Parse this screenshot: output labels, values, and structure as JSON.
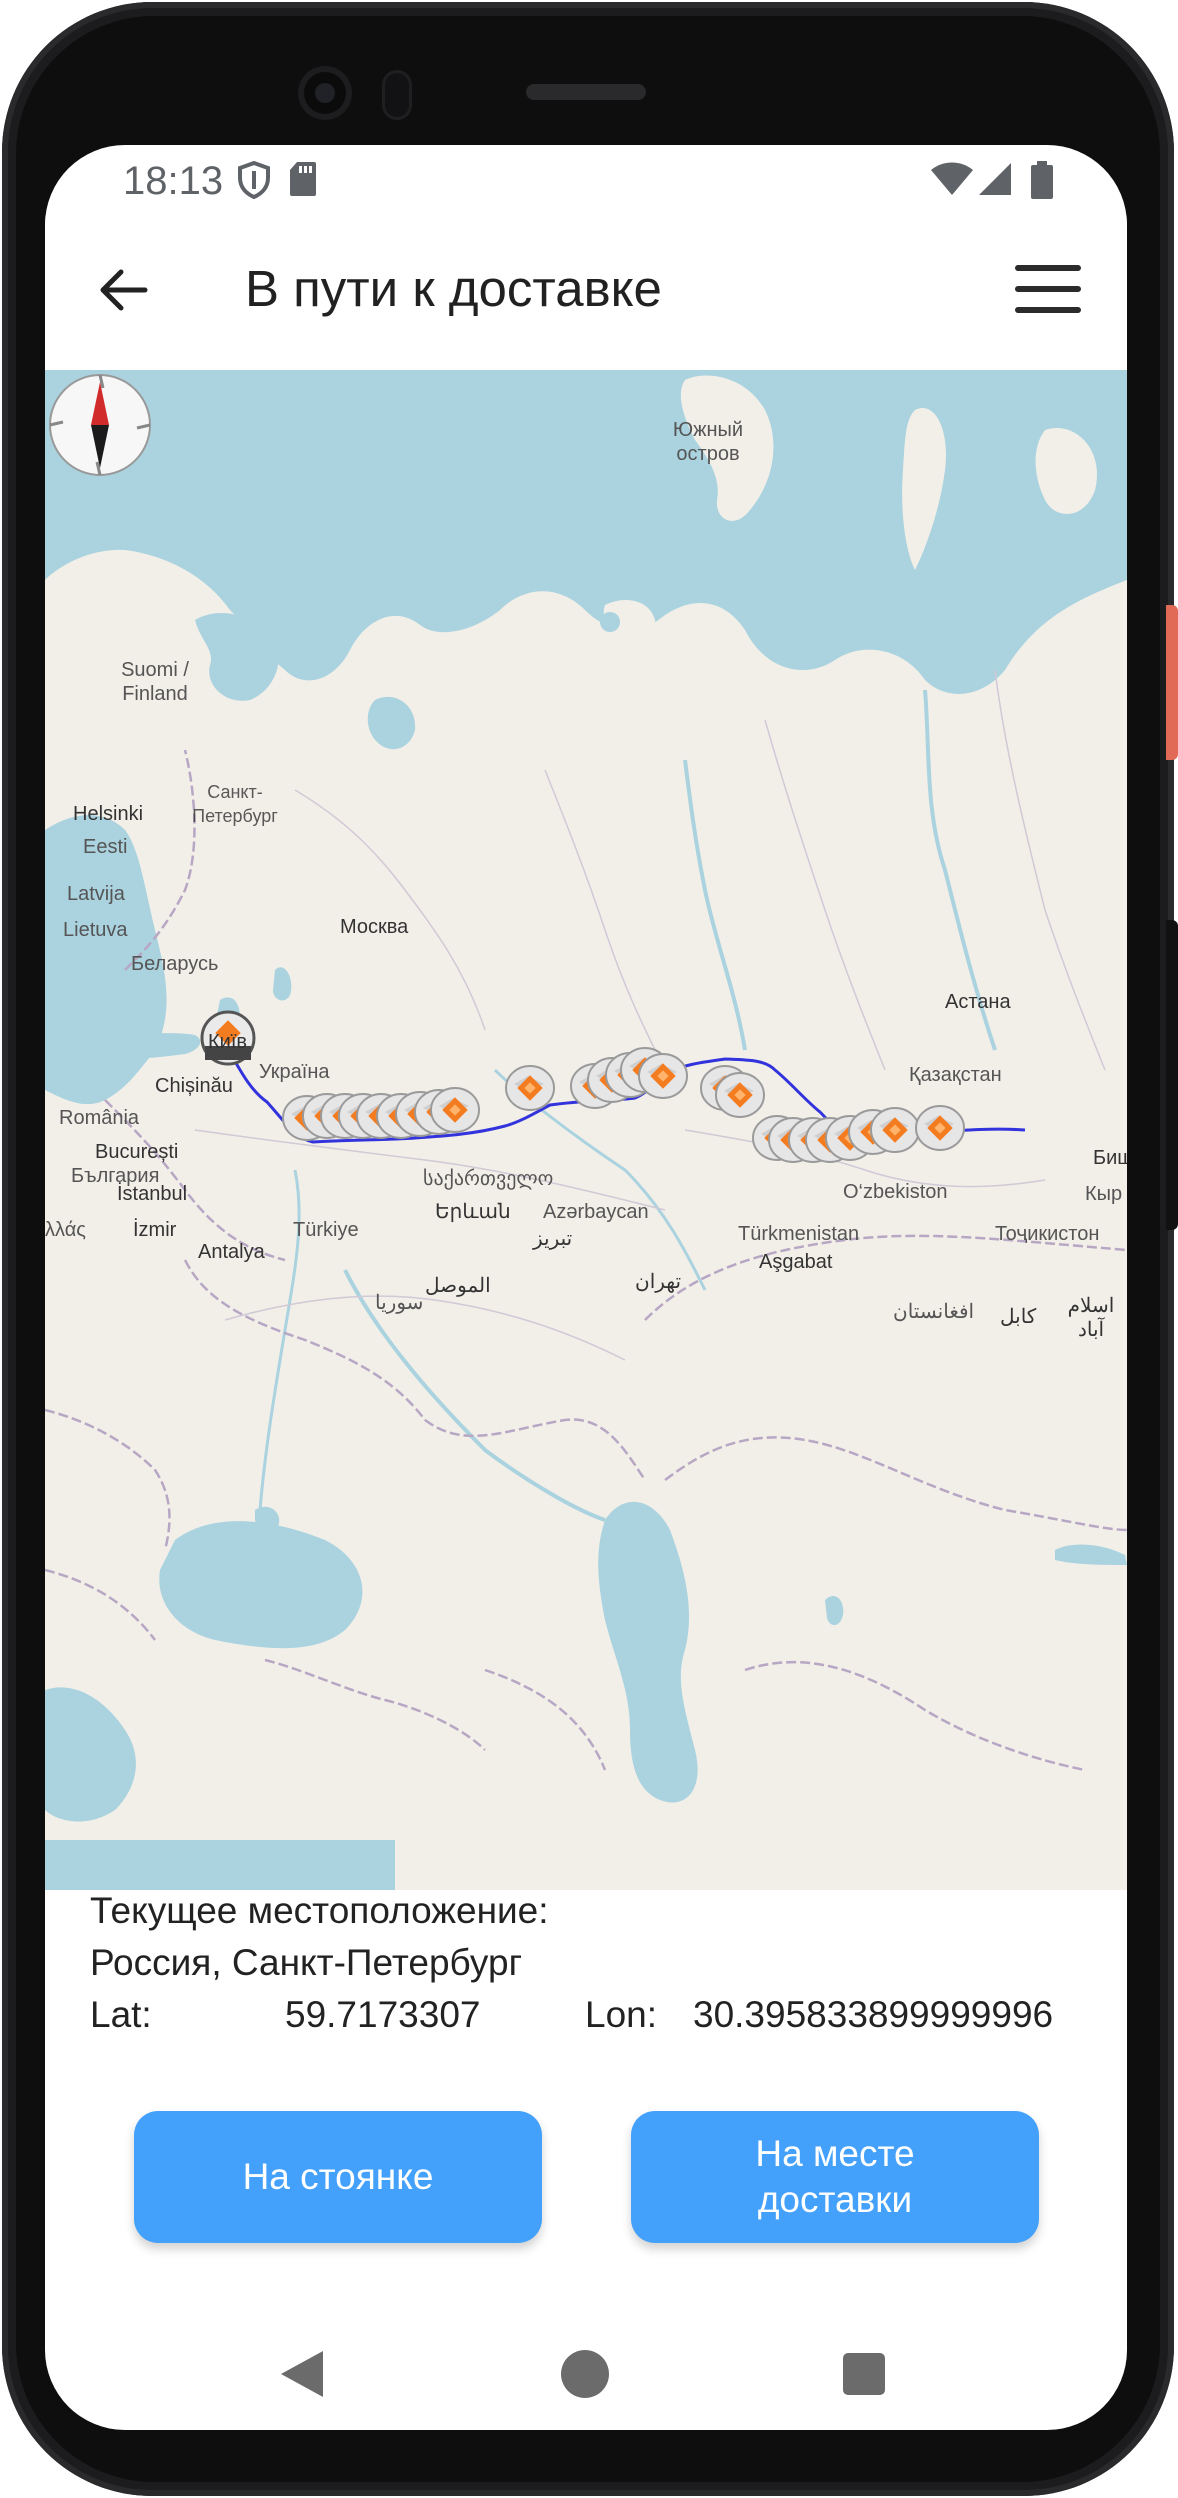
{
  "status_bar": {
    "time": "18:13",
    "icons": [
      "shield-icon",
      "sd-card-icon",
      "wifi-icon",
      "signal-icon",
      "battery-icon"
    ]
  },
  "app_bar": {
    "title": "В пути к доставке",
    "back_icon": "arrow-back-icon",
    "menu_icon": "hamburger-menu-icon"
  },
  "map": {
    "compass_icon": "compass-icon",
    "labels": {
      "south_island": "Южный остров",
      "finland": "Suomi / Finland",
      "saint_petersburg": "Санкт-Петербург",
      "helsinki": "Helsinki",
      "estonia": "Eesti",
      "latvia": "Latvija",
      "lithuania": "Lietuva",
      "moscow": "Москва",
      "belarus": "Беларусь",
      "kyiv": "Київ",
      "ukraine": "Україна",
      "chisinau": "Chișinău",
      "romania": "România",
      "bucharest": "București",
      "bulgaria": "България",
      "istanbul": "İstanbul",
      "izmir": "İzmir",
      "antalya": "Antalya",
      "turkey": "Türkiye",
      "georgia": "საქართველო",
      "yerevan": "Երևան",
      "azerbaijan": "Azərbaycan",
      "tabriz": "تبریز",
      "mosul": "الموصل",
      "syria": "سوريا",
      "tehran": "تهران",
      "astana": "Астана",
      "kazakhstan": "Қазақстан",
      "uzbekistan": "O‘zbekiston",
      "turkmenistan": "Türkmenistan",
      "ashgabat": "Aşgabat",
      "afghanistan": "افغانستان",
      "kabul": "کابل",
      "kyrgyzstan": "Кыр",
      "tajikistan": "Тоҷикистон",
      "bishkek": "Биш",
      "islamabad": "اسلام آباد",
      "greece_edge": "λλάς"
    }
  },
  "location": {
    "header": "Текущее местоположение:",
    "place": "Россия, Санкт-Петербург",
    "lat_label": "Lat:",
    "lat_value": "59.7173307",
    "lon_label": "Lon:",
    "lon_value": "30.395833899999996"
  },
  "buttons": {
    "parking": "На стоянке",
    "delivered_line1": "На месте",
    "delivered_line2": "доставки"
  },
  "nav": {
    "back": "nav-back-icon",
    "home": "nav-home-icon",
    "recents": "nav-recents-icon"
  },
  "colors": {
    "accent": "#44a1fb",
    "route": "#3333dd",
    "marker": "#f47c20",
    "water": "#aad3df",
    "land": "#f2efe9"
  }
}
